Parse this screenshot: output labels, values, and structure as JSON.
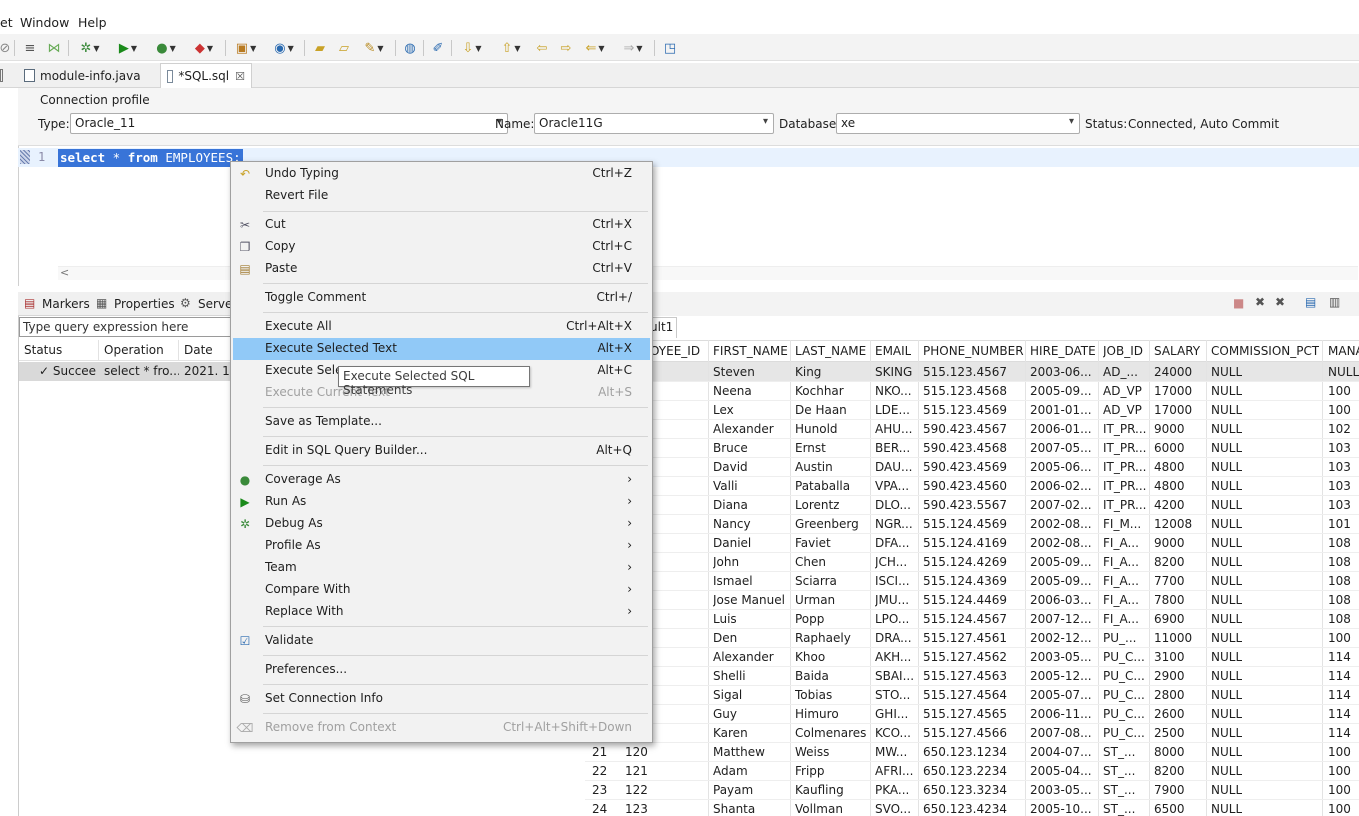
{
  "menubar": {
    "items": [
      "et",
      "Window",
      "Help"
    ]
  },
  "tabs": [
    {
      "label": "module-info.java"
    },
    {
      "label": "*SQL.sql",
      "close": "☒"
    }
  ],
  "connection": {
    "title": "Connection profile",
    "type_label": "Type:",
    "type_value": "Oracle_11",
    "name_label": "Name:",
    "name_value": "Oracle11G",
    "database_label": "Database:",
    "database_value": "xe",
    "status_label": "Status:",
    "status_value": "Connected, Auto Commit"
  },
  "editor": {
    "line_number": "1",
    "kw1": "select",
    "star": " * ",
    "kw2": "from",
    "rest": " EMPLOYEES;",
    "scroll_arrow": "<"
  },
  "views": {
    "markers": "Markers",
    "properties": "Properties",
    "servers": "Server"
  },
  "history": {
    "query_placeholder": "Type query expression here",
    "headers": [
      "Status",
      "Operation",
      "Date"
    ],
    "row": {
      "status": "✓ Succee",
      "operation": "select * fro...",
      "date": "2021. 10"
    }
  },
  "results": {
    "tab_label": "ult1",
    "headers": [
      "OYEE_ID",
      "FIRST_NAME",
      "LAST_NAME",
      "EMAIL",
      "PHONE_NUMBER",
      "HIRE_DATE",
      "JOB_ID",
      "SALARY",
      "COMMISSION_PCT",
      "MANA"
    ],
    "rows": [
      [
        "",
        "",
        "Steven",
        "King",
        "SKING",
        "515.123.4567",
        "2003-06...",
        "AD_...",
        "24000",
        "NULL",
        "NULL"
      ],
      [
        "",
        "",
        "Neena",
        "Kochhar",
        "NKO...",
        "515.123.4568",
        "2005-09...",
        "AD_VP",
        "17000",
        "NULL",
        "100"
      ],
      [
        "",
        "",
        "Lex",
        "De Haan",
        "LDE...",
        "515.123.4569",
        "2001-01...",
        "AD_VP",
        "17000",
        "NULL",
        "100"
      ],
      [
        "",
        "",
        "Alexander",
        "Hunold",
        "AHU...",
        "590.423.4567",
        "2006-01...",
        "IT_PR...",
        "9000",
        "NULL",
        "102"
      ],
      [
        "",
        "",
        "Bruce",
        "Ernst",
        "BER...",
        "590.423.4568",
        "2007-05...",
        "IT_PR...",
        "6000",
        "NULL",
        "103"
      ],
      [
        "",
        "",
        "David",
        "Austin",
        "DAU...",
        "590.423.4569",
        "2005-06...",
        "IT_PR...",
        "4800",
        "NULL",
        "103"
      ],
      [
        "",
        "",
        "Valli",
        "Pataballa",
        "VPA...",
        "590.423.4560",
        "2006-02...",
        "IT_PR...",
        "4800",
        "NULL",
        "103"
      ],
      [
        "",
        "",
        "Diana",
        "Lorentz",
        "DLO...",
        "590.423.5567",
        "2007-02...",
        "IT_PR...",
        "4200",
        "NULL",
        "103"
      ],
      [
        "",
        "",
        "Nancy",
        "Greenberg",
        "NGR...",
        "515.124.4569",
        "2002-08...",
        "FI_M...",
        "12008",
        "NULL",
        "101"
      ],
      [
        "",
        "",
        "Daniel",
        "Faviet",
        "DFA...",
        "515.124.4169",
        "2002-08...",
        "FI_A...",
        "9000",
        "NULL",
        "108"
      ],
      [
        "",
        "",
        "John",
        "Chen",
        "JCH...",
        "515.124.4269",
        "2005-09...",
        "FI_A...",
        "8200",
        "NULL",
        "108"
      ],
      [
        "",
        "",
        "Ismael",
        "Sciarra",
        "ISCI...",
        "515.124.4369",
        "2005-09...",
        "FI_A...",
        "7700",
        "NULL",
        "108"
      ],
      [
        "",
        "",
        "Jose Manuel",
        "Urman",
        "JMU...",
        "515.124.4469",
        "2006-03...",
        "FI_A...",
        "7800",
        "NULL",
        "108"
      ],
      [
        "",
        "",
        "Luis",
        "Popp",
        "LPO...",
        "515.124.4567",
        "2007-12...",
        "FI_A...",
        "6900",
        "NULL",
        "108"
      ],
      [
        "",
        "",
        "Den",
        "Raphaely",
        "DRA...",
        "515.127.4561",
        "2002-12...",
        "PU_...",
        "11000",
        "NULL",
        "100"
      ],
      [
        "",
        "",
        "Alexander",
        "Khoo",
        "AKH...",
        "515.127.4562",
        "2003-05...",
        "PU_C...",
        "3100",
        "NULL",
        "114"
      ],
      [
        "",
        "",
        "Shelli",
        "Baida",
        "SBAI...",
        "515.127.4563",
        "2005-12...",
        "PU_C...",
        "2900",
        "NULL",
        "114"
      ],
      [
        "",
        "",
        "Sigal",
        "Tobias",
        "STO...",
        "515.127.4564",
        "2005-07...",
        "PU_C...",
        "2800",
        "NULL",
        "114"
      ],
      [
        "",
        "",
        "Guy",
        "Himuro",
        "GHI...",
        "515.127.4565",
        "2006-11...",
        "PU_C...",
        "2600",
        "NULL",
        "114"
      ],
      [
        "",
        "",
        "Karen",
        "Colmenares",
        "KCO...",
        "515.127.4566",
        "2007-08...",
        "PU_C...",
        "2500",
        "NULL",
        "114"
      ],
      [
        "21",
        "120",
        "Matthew",
        "Weiss",
        "MW...",
        "650.123.1234",
        "2004-07...",
        "ST_...",
        "8000",
        "NULL",
        "100"
      ],
      [
        "22",
        "121",
        "Adam",
        "Fripp",
        "AFRI...",
        "650.123.2234",
        "2005-04...",
        "ST_...",
        "8200",
        "NULL",
        "100"
      ],
      [
        "23",
        "122",
        "Payam",
        "Kaufling",
        "PKA...",
        "650.123.3234",
        "2003-05...",
        "ST_...",
        "7900",
        "NULL",
        "100"
      ],
      [
        "24",
        "123",
        "Shanta",
        "Vollman",
        "SVO...",
        "650.123.4234",
        "2005-10...",
        "ST_...",
        "6500",
        "NULL",
        "100"
      ]
    ]
  },
  "context_menu": {
    "items": [
      {
        "label": "Undo Typing",
        "shortcut": "Ctrl+Z",
        "icon": "undo-icon"
      },
      {
        "label": "Revert File",
        "shortcut": ""
      },
      {
        "label": "Cut",
        "shortcut": "Ctrl+X",
        "icon": "cut-icon"
      },
      {
        "label": "Copy",
        "shortcut": "Ctrl+C",
        "icon": "copy-icon"
      },
      {
        "label": "Paste",
        "shortcut": "Ctrl+V",
        "icon": "paste-icon"
      },
      {
        "label": "Toggle Comment",
        "shortcut": "Ctrl+/"
      },
      {
        "label": "Execute All",
        "shortcut": "Ctrl+Alt+X"
      },
      {
        "label": "Execute Selected Text",
        "shortcut": "Alt+X"
      },
      {
        "label": "Execute Selec",
        "shortcut": "Alt+C"
      },
      {
        "label": "Execute Current Text",
        "shortcut": "Alt+S"
      },
      {
        "label": "Save as Template...",
        "shortcut": ""
      },
      {
        "label": "Edit in SQL Query Builder...",
        "shortcut": "Alt+Q"
      },
      {
        "label": "Coverage As",
        "shortcut": "›",
        "icon": "coverage-icon"
      },
      {
        "label": "Run As",
        "shortcut": "›",
        "icon": "run-icon"
      },
      {
        "label": "Debug As",
        "shortcut": "›",
        "icon": "debug-icon"
      },
      {
        "label": "Profile As",
        "shortcut": "›"
      },
      {
        "label": "Team",
        "shortcut": "›"
      },
      {
        "label": "Compare With",
        "shortcut": "›"
      },
      {
        "label": "Replace With",
        "shortcut": "›"
      },
      {
        "label": "Validate",
        "shortcut": "",
        "icon": "checkbox-icon"
      },
      {
        "label": "Preferences...",
        "shortcut": ""
      },
      {
        "label": "Set Connection Info",
        "shortcut": "",
        "icon": "connection-icon"
      },
      {
        "label": "Remove from Context",
        "shortcut": "Ctrl+Alt+Shift+Down",
        "icon": "remove-context-icon"
      }
    ]
  },
  "tooltip": "Execute Selected SQL Statements",
  "colors": {
    "selection": "#3874d8",
    "menu_highlight": "#91c9f7",
    "current_line": "#e8f2fe"
  }
}
